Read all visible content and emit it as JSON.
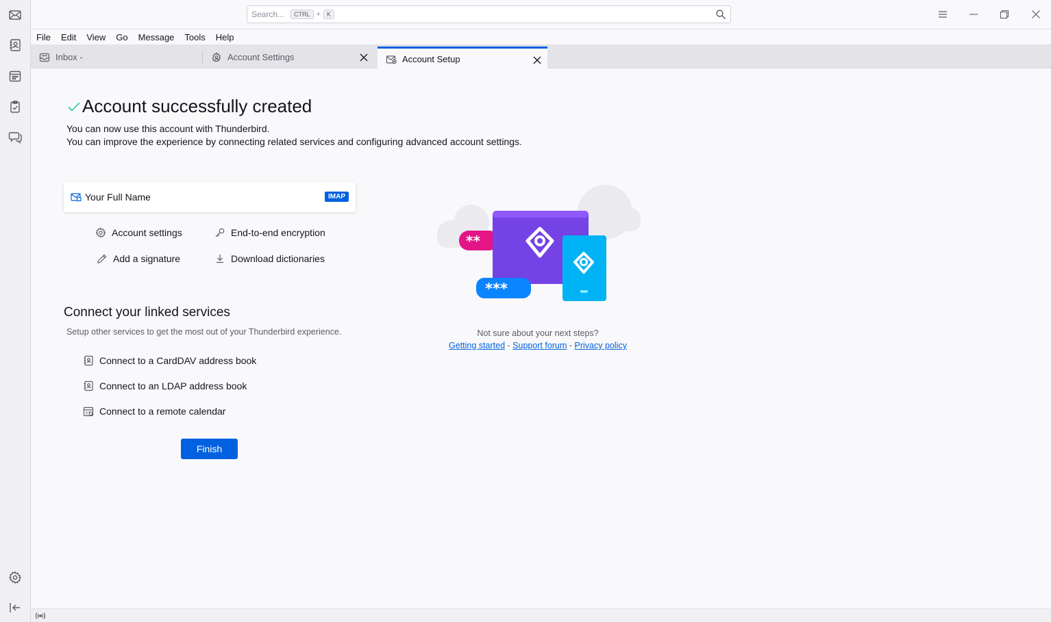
{
  "spaces": [
    "mail-icon",
    "address-book-icon",
    "calendar-icon",
    "tasks-icon",
    "chat-icon",
    "settings-icon",
    "collapse-icon"
  ],
  "search": {
    "placeholder": "Search...",
    "kbd1": "CTRL",
    "plus": "+",
    "kbd2": "K"
  },
  "menu": [
    "File",
    "Edit",
    "View",
    "Go",
    "Message",
    "Tools",
    "Help"
  ],
  "tabs": [
    {
      "label": "Inbox -",
      "closable": false
    },
    {
      "label": "Account Settings",
      "closable": true
    },
    {
      "label": "Account Setup",
      "closable": true,
      "active": true
    }
  ],
  "main": {
    "heading": "Account successfully created",
    "desc1": "You can now use this account with Thunderbird.",
    "desc2": "You can improve the experience by connecting related services and configuring advanced account settings.",
    "account": {
      "name": "Your Full Name",
      "badge": "IMAP"
    },
    "actions": {
      "account_settings": "Account settings",
      "encryption": "End-to-end encryption",
      "signature": "Add a signature",
      "dictionaries": "Download dictionaries"
    },
    "linked_title": "Connect your linked services",
    "linked_desc": "Setup other services to get the most out of your Thunderbird experience.",
    "linked": {
      "carddav": "Connect to a CardDAV address book",
      "ldap": "Connect to an LDAP address book",
      "calendar": "Connect to a remote calendar"
    },
    "finish": "Finish"
  },
  "help": {
    "question": "Not sure about your next steps?",
    "getting_started": "Getting started",
    "sep": "-",
    "support": "Support forum",
    "privacy": "Privacy policy"
  },
  "colors": {
    "accent": "#0061e0",
    "check": "#2ac3a2",
    "purple": "#7542e5",
    "cyan": "#00b3f4",
    "pink": "#e31587"
  }
}
